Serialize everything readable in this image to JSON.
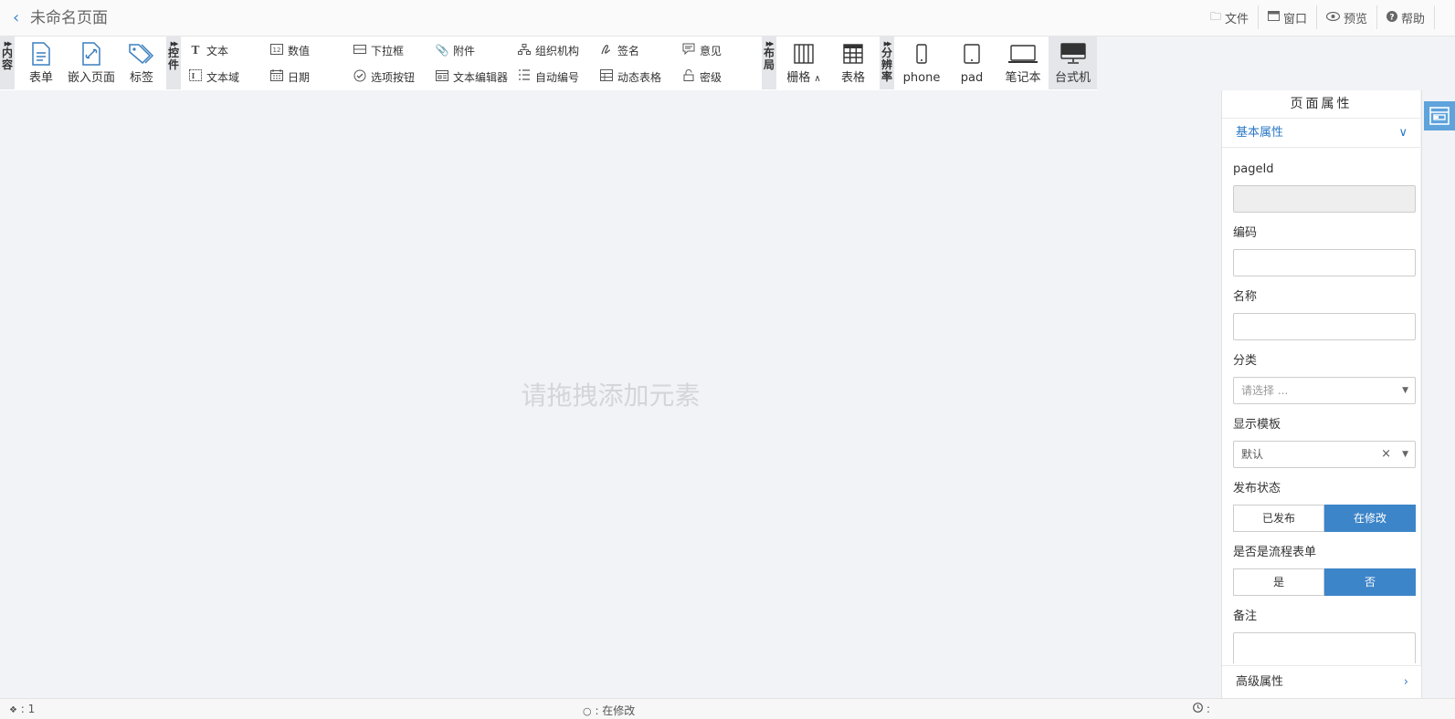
{
  "header": {
    "back_icon": "chevron-left-icon",
    "title": "未命名页面",
    "actions": [
      {
        "label": "文件",
        "icon": "folder-icon"
      },
      {
        "label": "窗口",
        "icon": "window-icon"
      },
      {
        "label": "预览",
        "icon": "eye-icon"
      },
      {
        "label": "帮助",
        "icon": "help-icon"
      }
    ]
  },
  "toolbar": {
    "groups": {
      "content": "内容",
      "controls": "控件",
      "layout": "布局",
      "resolution": "分辨率"
    },
    "content_items": [
      "表单",
      "嵌入页面",
      "标签"
    ],
    "controls_row1": [
      "文本",
      "数值",
      "下拉框",
      "附件",
      "组织机构",
      "签名",
      "意见"
    ],
    "controls_row2": [
      "文本域",
      "日期",
      "选项按钮",
      "文本编辑器",
      "自动编号",
      "动态表格",
      "密级"
    ],
    "layout_items": [
      "栅格",
      "表格"
    ],
    "resolution_items": [
      "phone",
      "pad",
      "笔记本",
      "台式机"
    ],
    "active_resolution": "台式机"
  },
  "canvas": {
    "hint": "请拖拽添加元素"
  },
  "panel": {
    "title": "页面属性",
    "basic_section": "基本属性",
    "fields": {
      "pageid_label": "pageId",
      "pageid_value": "",
      "code_label": "编码",
      "code_value": "",
      "name_label": "名称",
      "name_value": "",
      "category_label": "分类",
      "category_placeholder": "请选择 ...",
      "template_label": "显示模板",
      "template_value": "默认",
      "publish_label": "发布状态",
      "publish_options": [
        "已发布",
        "在修改"
      ],
      "publish_selected": "在修改",
      "flow_label": "是否是流程表单",
      "flow_options": [
        "是",
        "否"
      ],
      "flow_selected": "否",
      "remark_label": "备注"
    },
    "advanced_section": "高级属性"
  },
  "status_bar": {
    "left": ": 1",
    "middle": ": 在修改",
    "right": ":"
  },
  "colors": {
    "accent": "#3d85c9",
    "link": "#2a78c4",
    "canvas_bg": "#f1f3f6"
  }
}
